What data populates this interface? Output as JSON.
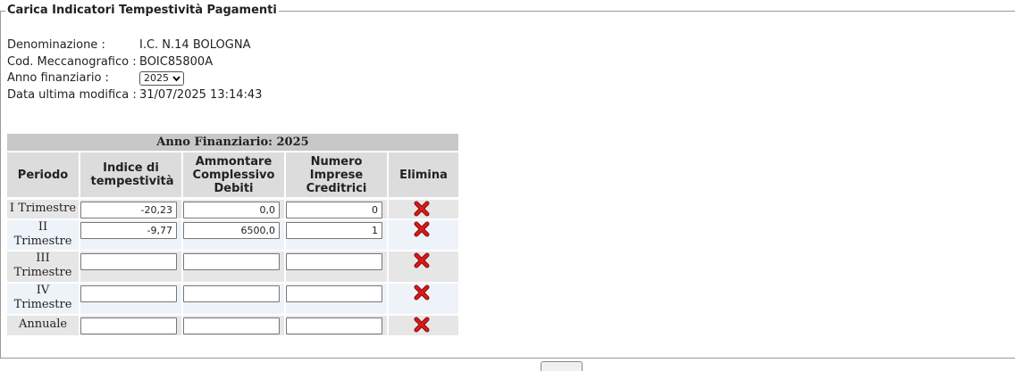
{
  "form": {
    "legend": "Carica Indicatori Tempestività Pagamenti"
  },
  "info": {
    "denominazione_label": "Denominazione :",
    "denominazione_value": "I.C. N.14 BOLOGNA",
    "codice_label": "Cod. Meccanografico :",
    "codice_value": "BOIC85800A",
    "anno_label": "Anno finanziario :",
    "anno_value": "2025",
    "data_label": "Data ultima modifica :",
    "data_value": "31/07/2025 13:14:43"
  },
  "grid": {
    "title": "Anno Finanziario: 2025",
    "headers": {
      "periodo": "Periodo",
      "indice": "Indice di tempestività",
      "ammontare": "Ammontare Complessivo Debiti",
      "numero": "Numero Imprese Creditrici",
      "elimina": "Elimina"
    },
    "rows": [
      {
        "periodo": "I Trimestre",
        "indice": "-20,23",
        "ammontare": "0,0",
        "numero": "0"
      },
      {
        "periodo": "II Trimestre",
        "indice": "-9,77",
        "ammontare": "6500,0",
        "numero": "1"
      },
      {
        "periodo": "III Trimestre",
        "indice": "",
        "ammontare": "",
        "numero": ""
      },
      {
        "periodo": "IV Trimestre",
        "indice": "",
        "ammontare": "",
        "numero": ""
      },
      {
        "periodo": "Annuale",
        "indice": "",
        "ammontare": "",
        "numero": ""
      }
    ],
    "delete_icon": "red-x-icon",
    "colors": {
      "title_bg": "#c8c8c8",
      "header_bg": "#dcdcdc",
      "row_alt": "#eef3fa",
      "row": "#e6e6e6",
      "delete": "#cc1111"
    }
  }
}
